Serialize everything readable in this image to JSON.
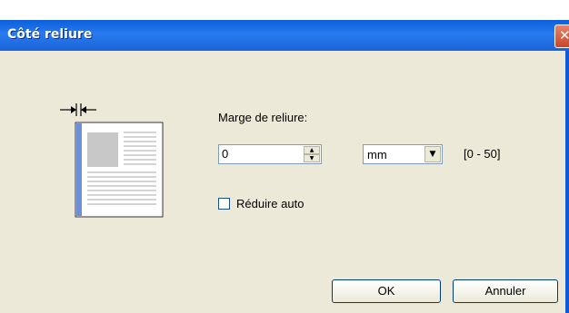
{
  "window": {
    "title": "Côté reliure"
  },
  "binding_margin": {
    "label": "Marge de reliure:",
    "value": "0",
    "unit": "mm",
    "range": "[0 - 50]"
  },
  "auto_reduce": {
    "label": "Réduire auto",
    "checked": false
  },
  "buttons": {
    "ok": "OK",
    "cancel": "Annuler"
  },
  "icons": {
    "close": "close-icon",
    "spin_up": "spin-up-icon",
    "spin_down": "spin-down-icon",
    "dropdown": "chevron-down-icon",
    "binding_preview": "page-binding-icon"
  }
}
